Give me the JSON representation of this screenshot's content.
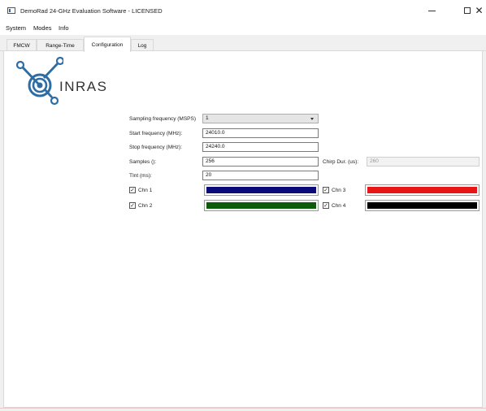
{
  "window": {
    "title": "DemoRad 24-GHz Evaluation Software - LICENSED"
  },
  "menu": {
    "items": [
      "System",
      "Modes",
      "Info"
    ]
  },
  "tabs": [
    "FMCW",
    "Range-Time",
    "Configuration",
    "Log"
  ],
  "active_tab": "Configuration",
  "logo": {
    "brand": "INRAS"
  },
  "config": {
    "sampling_frequency": {
      "label": "Sampling frequency (MSPS)",
      "value": "1"
    },
    "start_frequency": {
      "label": "Start frequency (MHz):",
      "value": "24010.0"
    },
    "stop_frequency": {
      "label": "Stop frequency (MHz):",
      "value": "24240.0"
    },
    "samples": {
      "label": "Samples ():",
      "value": "256"
    },
    "chirp_duration": {
      "label": "Chirp Dur. (us):",
      "value": "260"
    },
    "tint": {
      "label": "TInt (ms):",
      "value": "20"
    }
  },
  "channels": [
    {
      "label": "Chn 1",
      "checked": true,
      "color": "#0a0a78"
    },
    {
      "label": "Chn 2",
      "checked": true,
      "color": "#0c5c0c"
    },
    {
      "label": "Chn 3",
      "checked": true,
      "color": "#e81616"
    },
    {
      "label": "Chn 4",
      "checked": true,
      "color": "#000000"
    }
  ]
}
